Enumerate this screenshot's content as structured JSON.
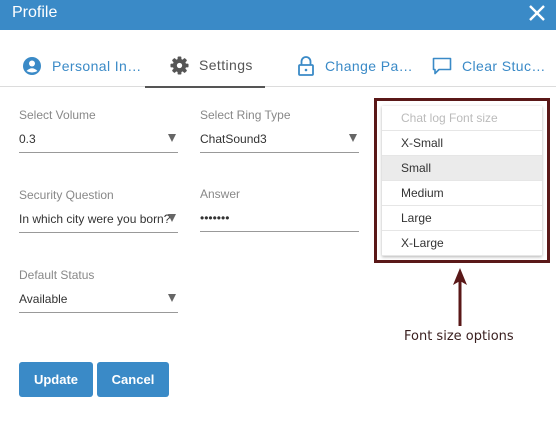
{
  "window": {
    "title": "Profile",
    "close_icon": "close-icon"
  },
  "tabs": [
    {
      "label": "Personal In…",
      "icon": "user-circle-icon",
      "active": false
    },
    {
      "label": "Settings",
      "icon": "gear-icon",
      "active": true
    },
    {
      "label": "Change Pa…",
      "icon": "lock-icon",
      "active": false
    },
    {
      "label": "Clear Stuc…",
      "icon": "chat-bubble-icon",
      "active": false
    }
  ],
  "settings": {
    "volume": {
      "label": "Select Volume",
      "value": "0.3"
    },
    "ring_type": {
      "label": "Select Ring Type",
      "value": "ChatSound3"
    },
    "security_question": {
      "label": "Security Question",
      "value": "In which city were you born?"
    },
    "answer": {
      "label": "Answer",
      "value": "•••••••"
    },
    "default_status": {
      "label": "Default Status",
      "value": "Available"
    }
  },
  "font_size_dropdown": {
    "header": "Chat log Font size",
    "options": [
      "X-Small",
      "Small",
      "Medium",
      "Large",
      "X-Large"
    ],
    "selected": "Small"
  },
  "buttons": {
    "update": "Update",
    "cancel": "Cancel"
  },
  "annotation": {
    "text": "Font size options"
  },
  "colors": {
    "primary": "#3a8ac7",
    "annotation": "#5a1818"
  }
}
